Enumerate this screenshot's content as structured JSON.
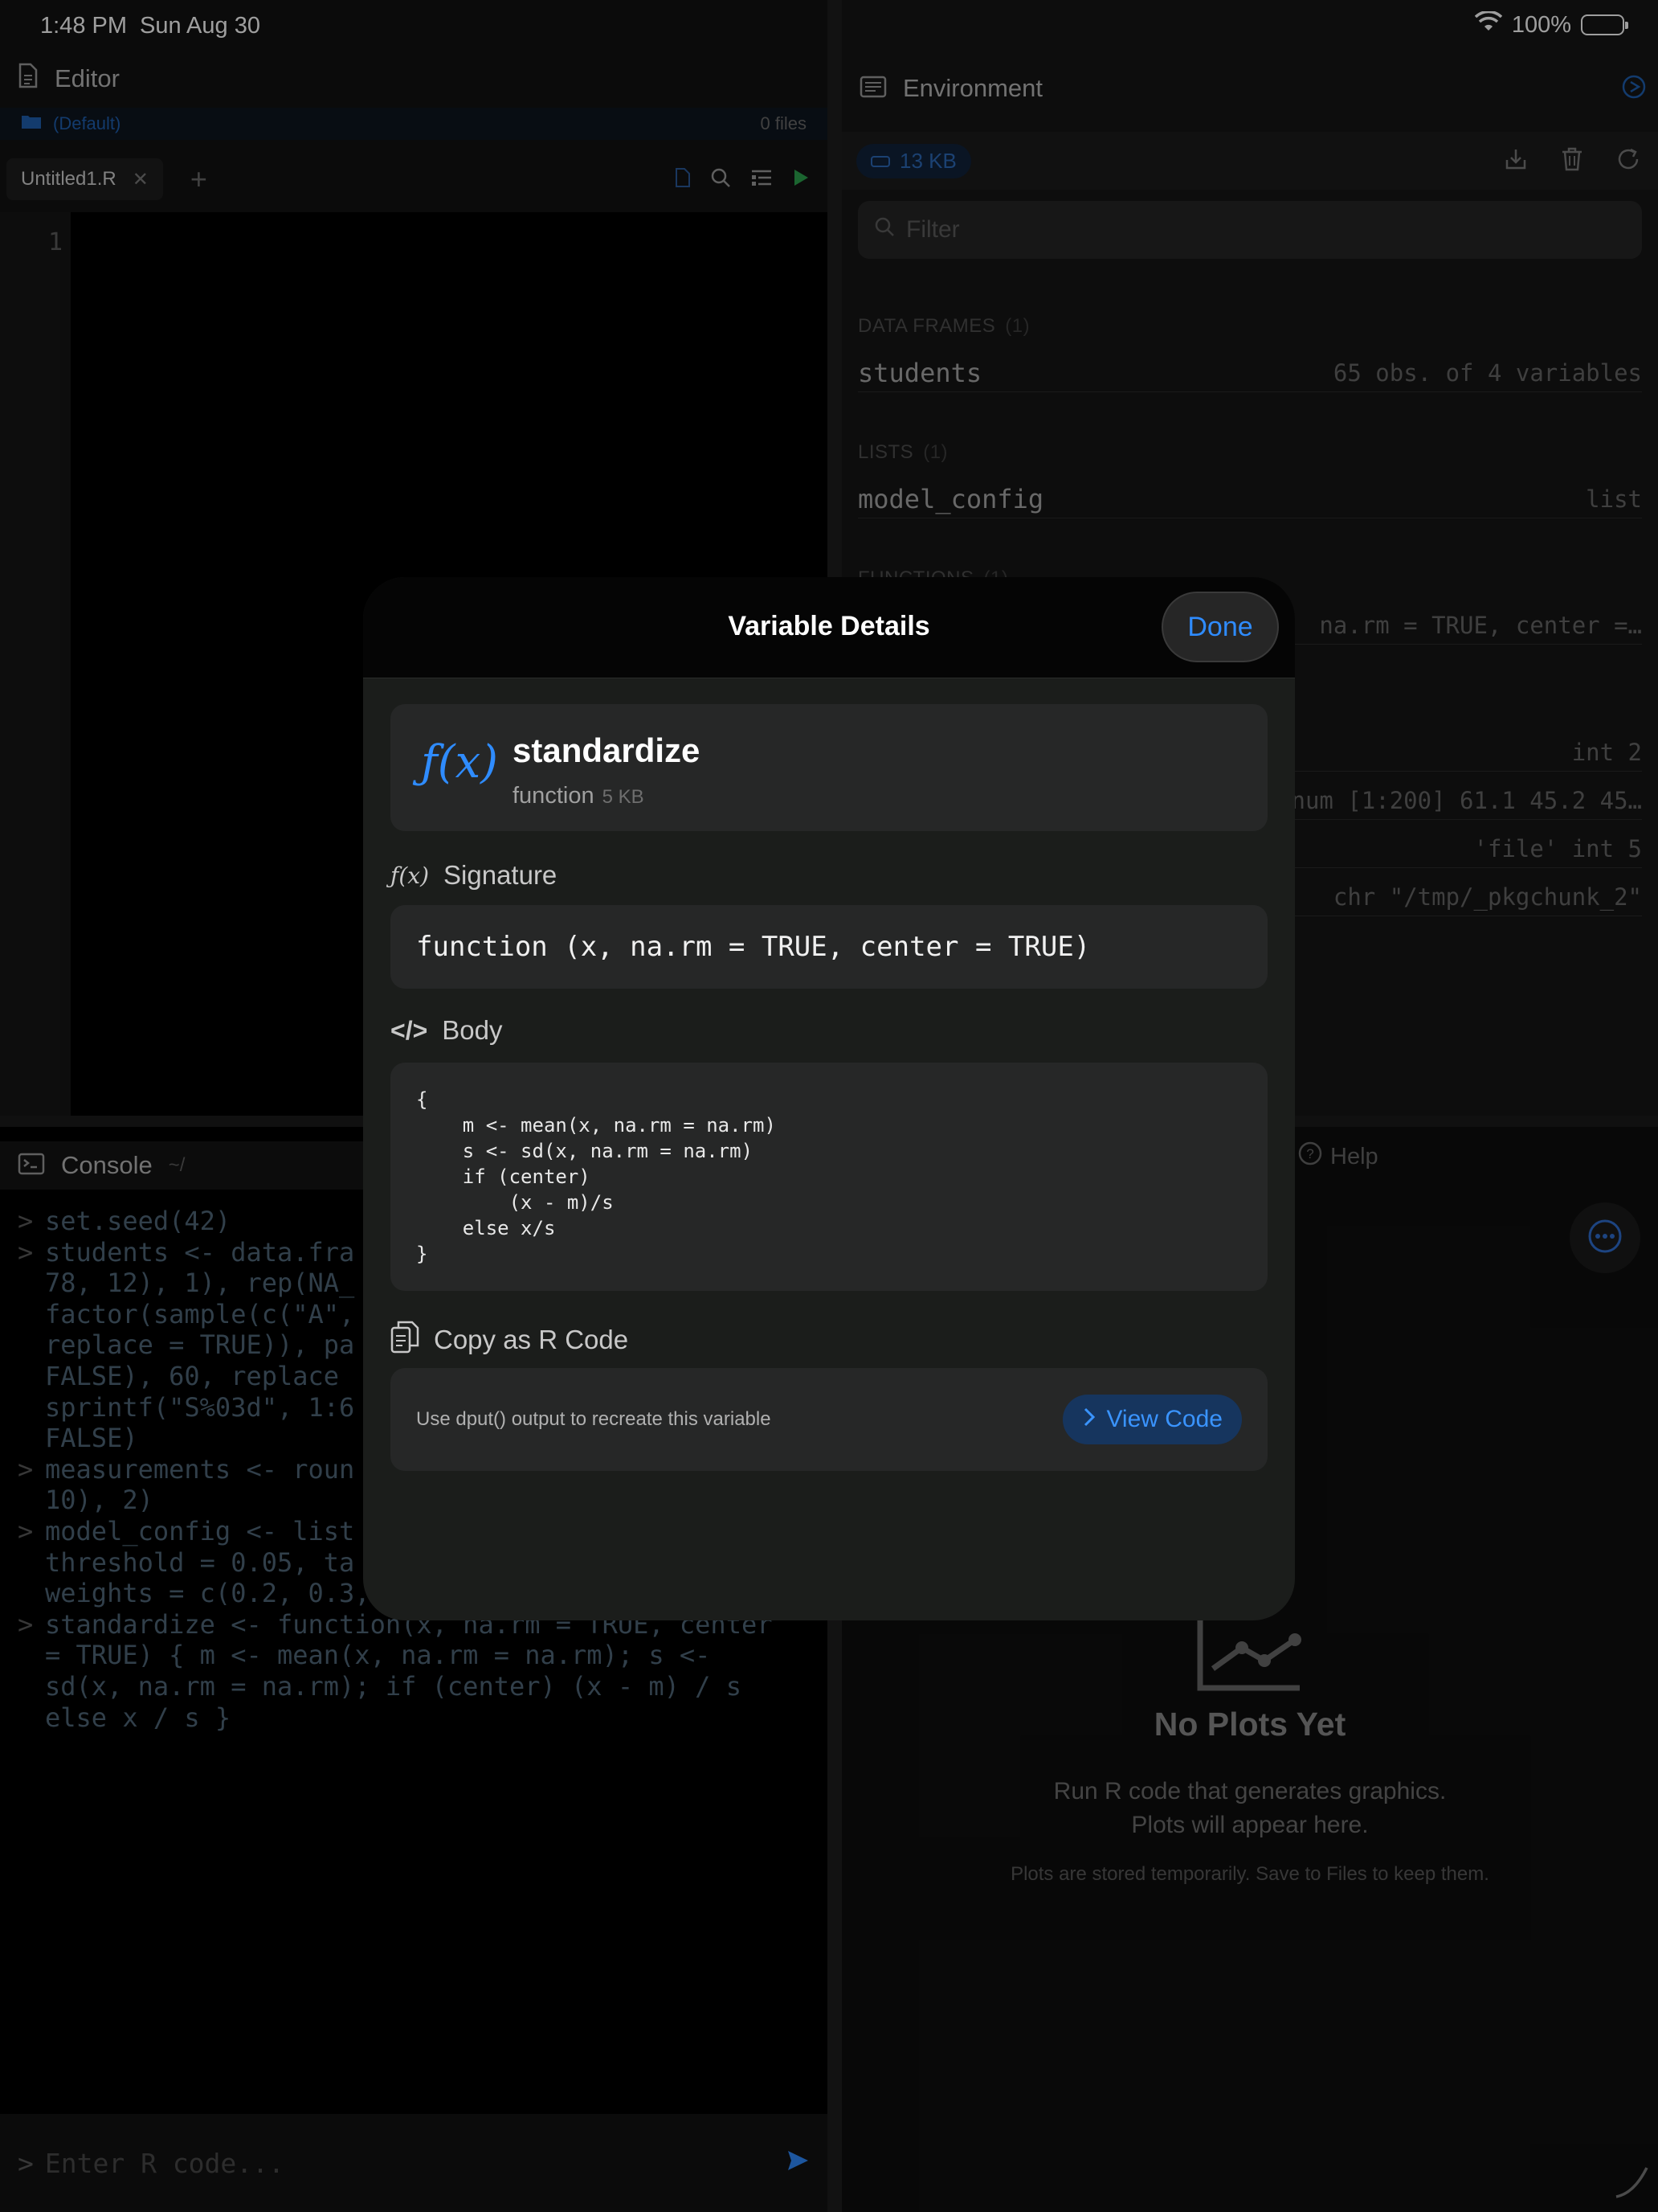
{
  "status_bar": {
    "time": "1:48 PM",
    "date": "Sun Aug 30",
    "battery": "100%"
  },
  "editor": {
    "title": "Editor",
    "folder": "(Default)",
    "file_count": "0 files",
    "tab_label": "Untitled1.R",
    "line_numbers": [
      "1"
    ]
  },
  "console": {
    "title": "Console",
    "path": "~/",
    "lines": [
      {
        "prompt": ">",
        "text": "set.seed(42)"
      },
      {
        "prompt": ">",
        "text": "students <- data.fra"
      },
      {
        "prompt": "",
        "text": "78, 12), 1), rep(NA_"
      },
      {
        "prompt": "",
        "text": "factor(sample(c(\"A\","
      },
      {
        "prompt": "",
        "text": "replace = TRUE)), pa"
      },
      {
        "prompt": "",
        "text": "FALSE), 60, replace"
      },
      {
        "prompt": "",
        "text": "sprintf(\"S%03d\", 1:6"
      },
      {
        "prompt": "",
        "text": "FALSE)"
      },
      {
        "prompt": ">",
        "text": "measurements <- roun"
      },
      {
        "prompt": "",
        "text": "10), 2)"
      },
      {
        "prompt": ">",
        "text": "model_config <- list"
      },
      {
        "prompt": "",
        "text": "threshold = 0.05, ta"
      },
      {
        "prompt": "",
        "text": "weights = c(0.2, 0.3,"
      },
      {
        "prompt": ">",
        "text": "standardize <- function(x, na.rm = TRUE, center"
      },
      {
        "prompt": "",
        "text": "= TRUE) { m <- mean(x, na.rm = na.rm); s <-"
      },
      {
        "prompt": "",
        "text": "sd(x, na.rm = na.rm); if (center) (x - m) / s"
      },
      {
        "prompt": "",
        "text": "else x / s }"
      }
    ],
    "input_placeholder": "Enter R code..."
  },
  "environment": {
    "title": "Environment",
    "memory": "13 KB",
    "filter_placeholder": "Filter",
    "sections": [
      {
        "title": "DATA FRAMES",
        "count": "(1)",
        "rows": [
          {
            "name": "students",
            "value": "65 obs. of 4 variables"
          }
        ]
      },
      {
        "title": "LISTS",
        "count": "(1)",
        "rows": [
          {
            "name": "model_config",
            "value": "list"
          }
        ]
      },
      {
        "title": "FUNCTIONS",
        "count": "(1)",
        "rows": [
          {
            "name": "",
            "value": "na.rm = TRUE, center =…"
          }
        ]
      }
    ],
    "value_rows": [
      "int 2",
      "num [1:200] 61.1 45.2 45…",
      "'file' int 5",
      "chr \"/tmp/_pkgchunk_2\""
    ]
  },
  "help": {
    "tab_label": "Help",
    "no_plots_title": "No Plots Yet",
    "no_plots_line1": "Run R code that generates graphics.",
    "no_plots_line2": "Plots will appear here.",
    "no_plots_note": "Plots are stored temporarily. Save to Files to keep them."
  },
  "modal": {
    "title": "Variable Details",
    "done_label": "Done",
    "icon_text": "ƒ(x)",
    "var_name": "standardize",
    "var_type": "function",
    "var_size": "5 KB",
    "signature_label": "Signature",
    "signature_icon_text": "ƒ(x)",
    "signature": "function (x, na.rm = TRUE, center = TRUE)",
    "body_label": "Body",
    "body_icon_text": "</>",
    "body_lines": [
      "{",
      "    m <- mean(x, na.rm = na.rm)",
      "    s <- sd(x, na.rm = na.rm)",
      "    if (center)",
      "        (x - m)/s",
      "    else x/s",
      "}"
    ],
    "copy_label": "Copy as R Code",
    "copy_description": "Use dput() output to recreate this variable",
    "view_code_label": "View Code"
  },
  "colors": {
    "accent": "#2f8cff",
    "background": "#000000",
    "modal": "#1b1d1b",
    "run": "#2da44e"
  }
}
